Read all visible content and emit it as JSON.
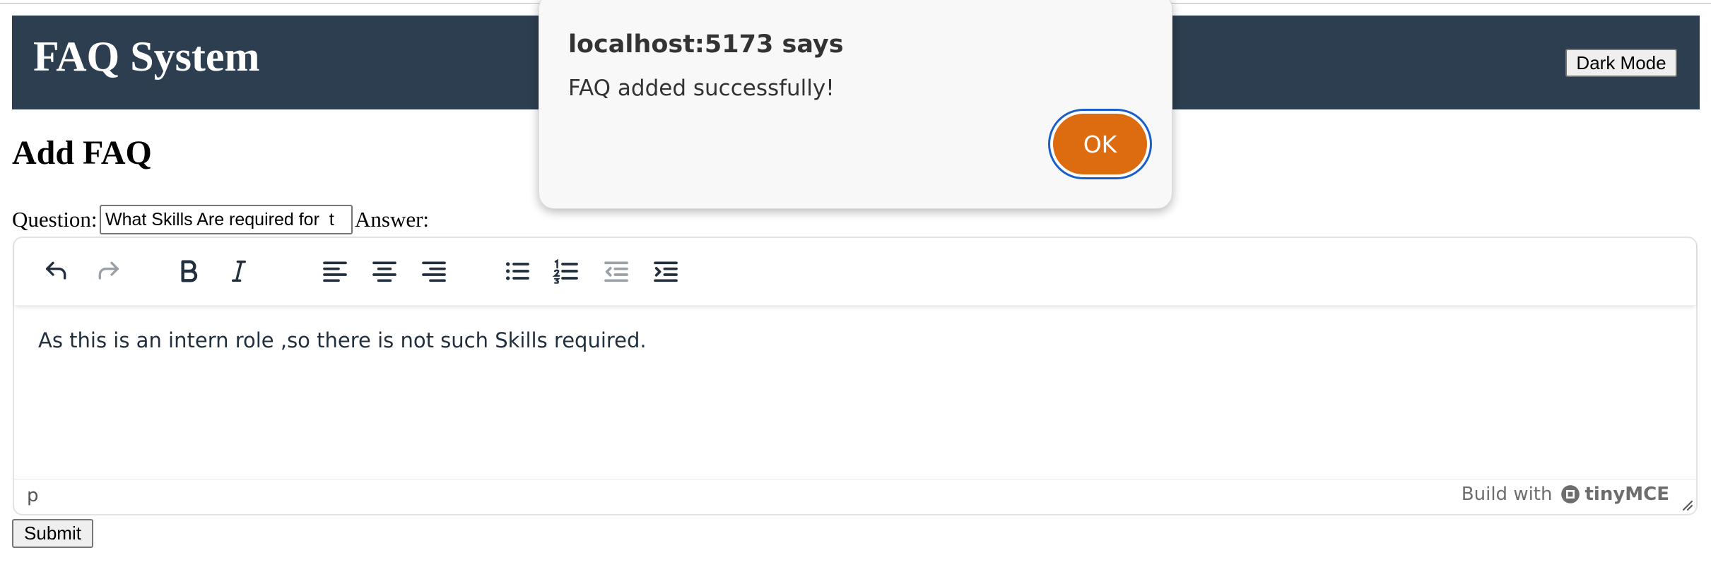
{
  "header": {
    "title": "FAQ System",
    "dark_mode_label": "Dark Mode",
    "background": "#2c3e50"
  },
  "page": {
    "heading": "Add FAQ"
  },
  "form": {
    "question_label": "Question:",
    "question_value": "What Skills Are required for  t",
    "answer_label": "Answer:",
    "submit_label": "Submit"
  },
  "editor": {
    "toolbar": [
      "undo-icon",
      "redo-icon",
      "bold-icon",
      "italic-icon",
      "align-left-icon",
      "align-center-icon",
      "align-right-icon",
      "bullet-list-icon",
      "numbered-list-icon",
      "outdent-icon",
      "indent-icon"
    ],
    "content": "As this is an intern role ,so there is not such Skills required.",
    "path": "p",
    "branding_prefix": "Build with",
    "branding_name": "tinyMCE"
  },
  "dialog": {
    "title": "localhost:5173 says",
    "message": "FAQ added successfully!",
    "ok_label": "OK",
    "accent": "#dd6b10"
  }
}
